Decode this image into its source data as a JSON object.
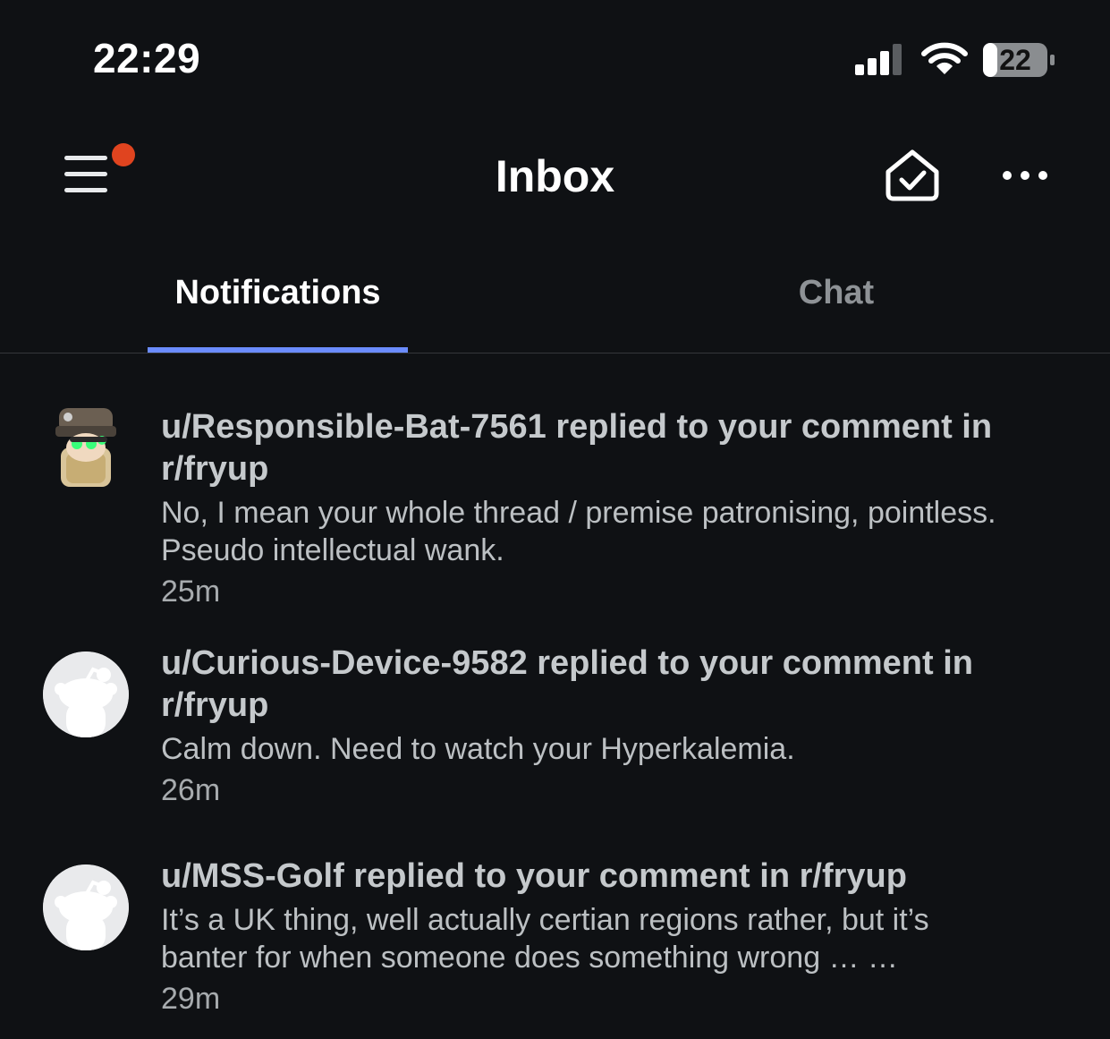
{
  "status_bar": {
    "time": "22:29",
    "battery_level": "22",
    "icons": [
      "signal-icon",
      "wifi-icon",
      "battery-icon"
    ]
  },
  "header": {
    "title": "Inbox",
    "icons": [
      "menu-icon",
      "mark-all-read-icon",
      "more-icon"
    ],
    "notification_dot_color": "#e0441f"
  },
  "tabs": [
    {
      "label": "Notifications",
      "active": true
    },
    {
      "label": "Chat",
      "active": false
    }
  ],
  "accent_color": "#6b8cff",
  "notifications": [
    {
      "title": "u/Responsible-Bat-7561 replied to your comment in r/fryup",
      "snippet": "No, I mean your whole thread / premise patronising, pointless.  Pseudo intellectual wank.",
      "time": "25m",
      "avatar": "custom-avatar"
    },
    {
      "title": "u/Curious-Device-9582 replied to your comment in r/fryup",
      "snippet": "Calm down. Need to watch your Hyperkalemia.",
      "time": "26m",
      "avatar": "default-snoo-avatar"
    },
    {
      "title": "u/MSS-Golf replied to your comment in r/fryup",
      "snippet": "It’s a UK thing, well actually certian regions rather, but it’s banter for when someone does something wrong … …",
      "time": "29m",
      "avatar": "default-snoo-avatar"
    }
  ]
}
